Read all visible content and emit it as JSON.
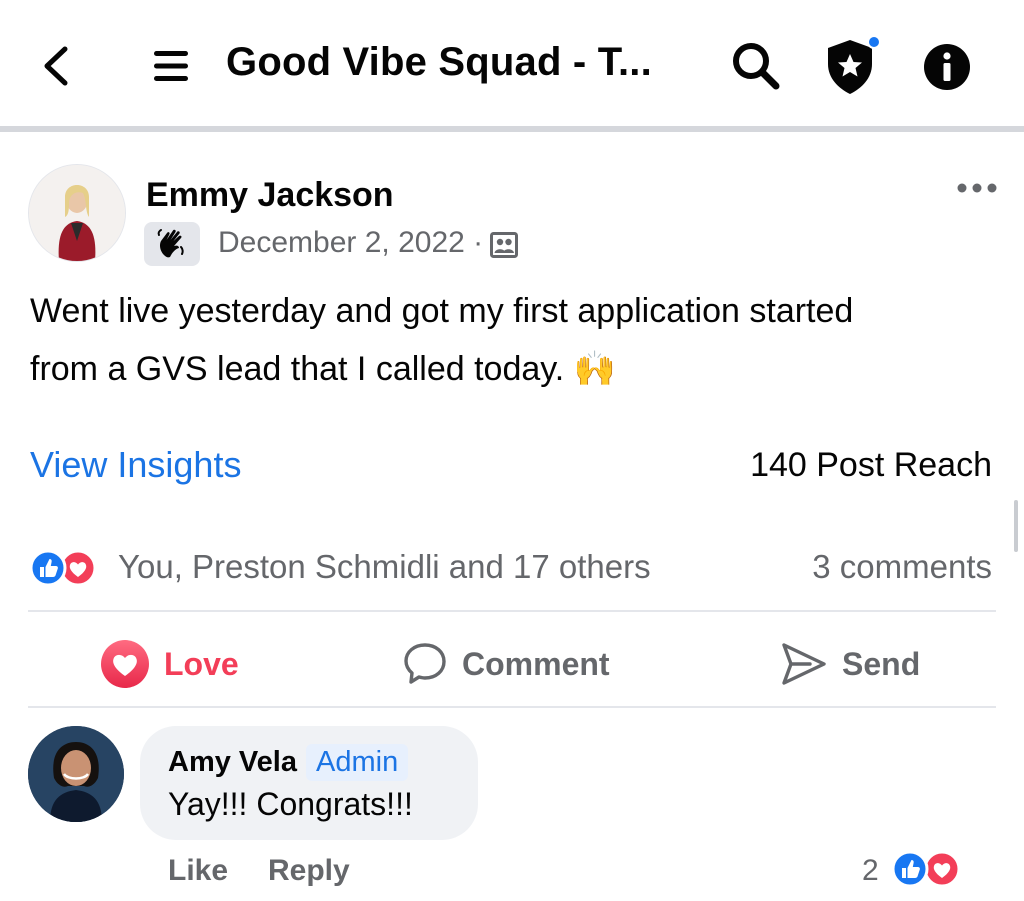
{
  "header": {
    "title": "Good Vibe Squad - T...",
    "icons": [
      "back-arrow-icon",
      "menu-icon",
      "search-icon",
      "admin-shield-icon",
      "info-icon"
    ]
  },
  "post": {
    "author": "Emmy Jackson",
    "date": "December 2, 2022 ·",
    "text_line1": "Went live yesterday and got my first application started",
    "text_line2": "from a GVS lead that I called today.",
    "emoji": "🙌",
    "insights_label": "View Insights",
    "reach": "140 Post Reach",
    "reactors": "You, Preston Schmidli and 17 others",
    "comments_count": "3 comments"
  },
  "actions": {
    "love": "Love",
    "comment": "Comment",
    "send": "Send"
  },
  "comment": {
    "author": "Amy Vela",
    "role": "Admin",
    "text": "Yay!!! Congrats!!!",
    "like": "Like",
    "reply": "Reply",
    "reaction_count": "2"
  },
  "colors": {
    "link_blue": "#1b74e4",
    "love_red": "#f33e58",
    "like_blue": "#1877f2",
    "muted_gray": "#65676b"
  }
}
